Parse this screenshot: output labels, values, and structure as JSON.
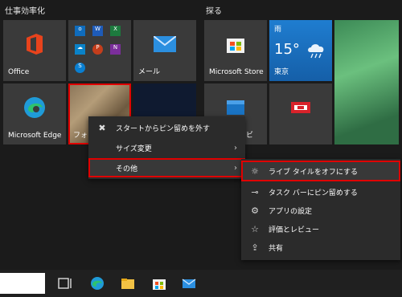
{
  "groups": {
    "left": "仕事効率化",
    "right": "探る"
  },
  "tiles": {
    "office": "Office",
    "mail": "メール",
    "edge": "Microsoft Edge",
    "photos": "フォト",
    "store": "Microsoft Store",
    "weather_city": "東京",
    "weather_temp": "15°",
    "weather_cond": "雨",
    "partial": "ビ"
  },
  "context_menu": {
    "unpin": "スタートからピン留めを外す",
    "resize": "サイズ変更",
    "more": "その他"
  },
  "submenu": {
    "live_tile_off": "ライブ タイルをオフにする",
    "pin_taskbar": "タスク バーにピン留めする",
    "app_settings": "アプリの設定",
    "rate_review": "評価とレビュー",
    "share": "共有"
  },
  "colors": {
    "accent_red": "#e00000",
    "weather_blue": "#1a74c4",
    "menu_bg": "#2b2b2b"
  }
}
